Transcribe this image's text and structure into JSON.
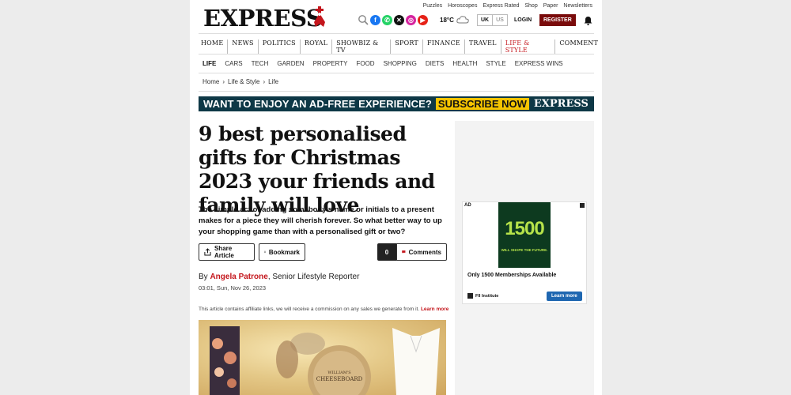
{
  "utility_links": [
    "Puzzles",
    "Horoscopes",
    "Express Rated",
    "Shop",
    "Paper",
    "Newsletters"
  ],
  "logo_text": "EXPRESS",
  "weather": "18°C",
  "region": {
    "active": "UK",
    "other": "US"
  },
  "login_label": "LOGIN",
  "register_label": "REGISTER",
  "main_nav": [
    "HOME",
    "NEWS",
    "POLITICS",
    "ROYAL",
    "SHOWBIZ & TV",
    "SPORT",
    "FINANCE",
    "TRAVEL",
    "LIFE & STYLE",
    "COMMENT"
  ],
  "main_nav_active": "LIFE & STYLE",
  "sub_nav": [
    "LIFE",
    "CARS",
    "TECH",
    "GARDEN",
    "PROPERTY",
    "FOOD",
    "SHOPPING",
    "DIETS",
    "HEALTH",
    "STYLE",
    "EXPRESS WINS"
  ],
  "breadcrumb": [
    "Home",
    "Life & Style",
    "Life"
  ],
  "banner": {
    "text": "WANT TO ENJOY AN AD-FREE EXPERIENCE?",
    "cta": "SUBSCRIBE NOW",
    "brand": "EXPRESS"
  },
  "article": {
    "title": "9 best personalised gifts for Christmas 2023 your friends and family will love",
    "standfirst": "The simple act of adding somebody's name or initials to a present makes for a piece they will cherish forever. So what better way to up your shopping game than with a personalised gift or two?",
    "share_label": "Share Article",
    "bookmark_label": "Bookmark",
    "comment_count": "0",
    "comments_label": "Comments",
    "byline_prefix": "By ",
    "author": "Angela Patrone",
    "author_role": ", Senior Lifestyle Reporter",
    "date": "03:01, Sun, Nov 26, 2023",
    "affiliate_note": "This article contains affiliate links, we will receive a commission on any sales we generate from it.",
    "learn_more": "Learn more",
    "hero_caption_text": "WILLIAM'S CHEESEBOARD"
  },
  "ad": {
    "label": "AD",
    "big_number": "1500",
    "tagline": "WILL SHAPE THE FUTURE.",
    "headline": "Only 1500 Memberships Available",
    "sponsor": "FII Institute",
    "cta": "Learn more"
  },
  "colors": {
    "accent_red": "#c4161c",
    "register_bg": "#7a0b0b",
    "banner_bg": "#0e3846",
    "banner_cta": "#f5c400",
    "ad_button": "#1f67b1"
  }
}
